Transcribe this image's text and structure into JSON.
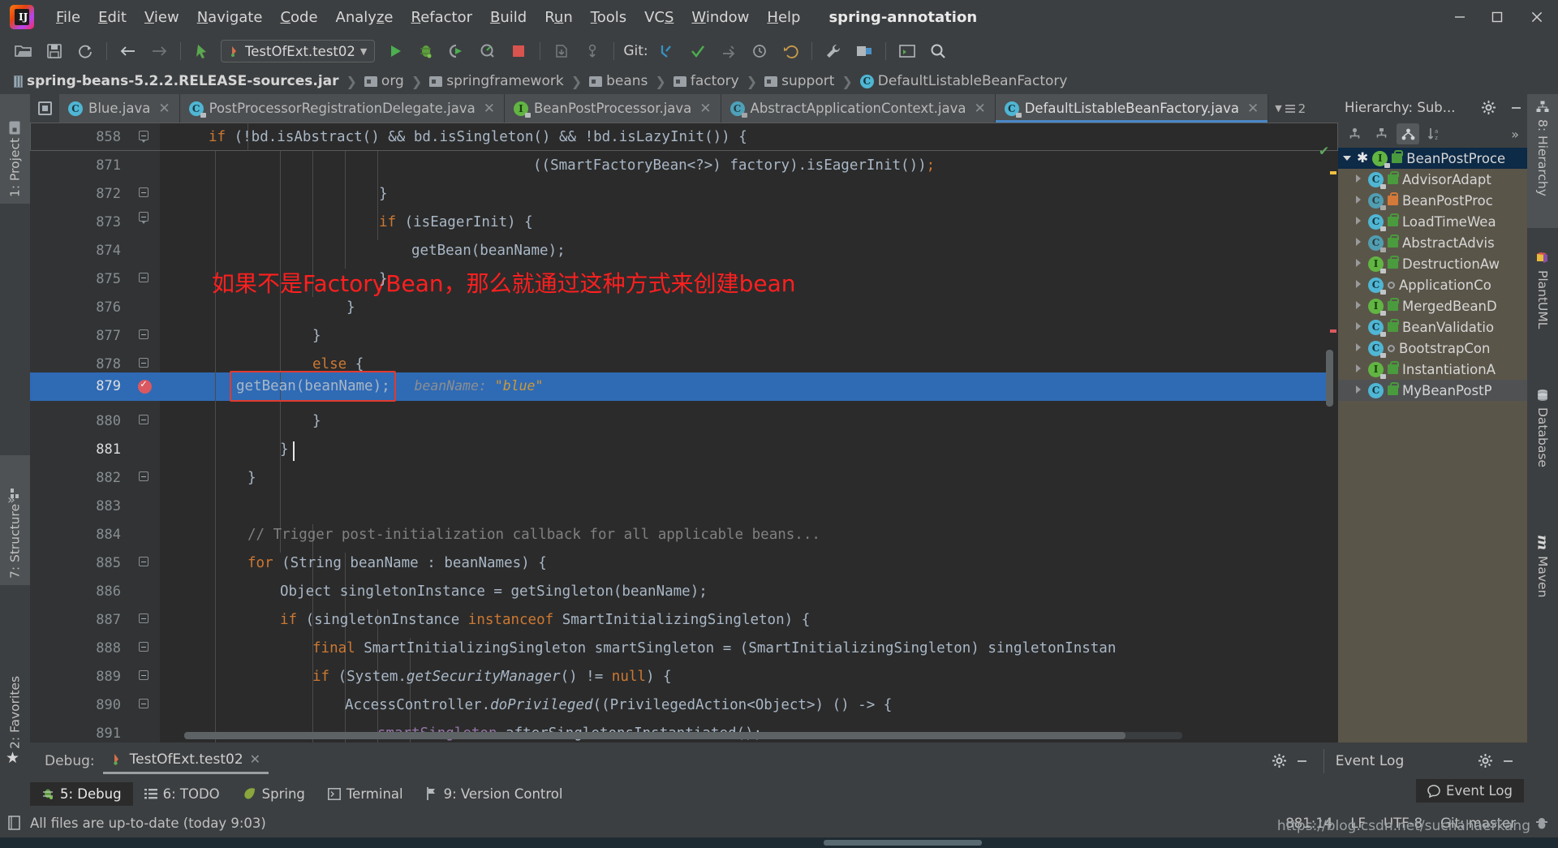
{
  "window": {
    "project_name": "spring-annotation",
    "minimize": "—",
    "maximize": "❐",
    "close": "✕"
  },
  "menu": {
    "items": [
      {
        "label": "File",
        "mnemonic": "F"
      },
      {
        "label": "Edit",
        "mnemonic": "E"
      },
      {
        "label": "View",
        "mnemonic": "V"
      },
      {
        "label": "Navigate",
        "mnemonic": "N"
      },
      {
        "label": "Code",
        "mnemonic": "C"
      },
      {
        "label": "Analyze",
        "mnemonic": "z"
      },
      {
        "label": "Refactor",
        "mnemonic": "R"
      },
      {
        "label": "Build",
        "mnemonic": "B"
      },
      {
        "label": "Run",
        "mnemonic": "u"
      },
      {
        "label": "Tools",
        "mnemonic": "T"
      },
      {
        "label": "VCS",
        "mnemonic": "S"
      },
      {
        "label": "Window",
        "mnemonic": "W"
      },
      {
        "label": "Help",
        "mnemonic": "H"
      }
    ]
  },
  "toolbar": {
    "run_config": "TestOfExt.test02",
    "git_label": "Git:",
    "icons": [
      "open-project-icon",
      "save-all-icon",
      "sync-icon",
      "back-icon",
      "forward-icon",
      "pointer-icon",
      "run-icon",
      "debug-icon",
      "run-coverage-icon",
      "profile-icon",
      "stop-icon",
      "attach-icon",
      "rerun-icon",
      "update-project-icon",
      "commit-icon",
      "push-icon",
      "settings-icon",
      "plugins-icon",
      "terminal-icon",
      "search-everywhere-icon"
    ]
  },
  "breadcrumb": {
    "items": [
      {
        "label": "spring-beans-5.2.2.RELEASE-sources.jar",
        "icon": "jar-icon"
      },
      {
        "label": "org",
        "icon": "folder-icon"
      },
      {
        "label": "springframework",
        "icon": "folder-icon"
      },
      {
        "label": "beans",
        "icon": "folder-icon"
      },
      {
        "label": "factory",
        "icon": "folder-icon"
      },
      {
        "label": "support",
        "icon": "folder-icon"
      },
      {
        "label": "DefaultListableBeanFactory",
        "icon": "class-icon"
      }
    ],
    "separator": "❯"
  },
  "editor_tabs": {
    "tabs": [
      {
        "label": "Blue.java",
        "icon": "class-icon",
        "kind": "c",
        "active": false,
        "locked": false
      },
      {
        "label": "PostProcessorRegistrationDelegate.java",
        "icon": "class-icon",
        "kind": "c",
        "active": false,
        "locked": true
      },
      {
        "label": "BeanPostProcessor.java",
        "icon": "interface-icon",
        "kind": "i",
        "active": false,
        "locked": true
      },
      {
        "label": "AbstractApplicationContext.java",
        "icon": "abstract-class-icon",
        "kind": "c",
        "active": false,
        "locked": true
      },
      {
        "label": "DefaultListableBeanFactory.java",
        "icon": "class-icon",
        "kind": "c",
        "active": true,
        "locked": true
      }
    ],
    "close_glyph": "✕",
    "overflow_count": "2"
  },
  "editor": {
    "filename": "DefaultListableBeanFactory.java",
    "annotation_note": "如果不是FactoryBean，那么就通过这种方式来创建bean",
    "annotation_color": "#ff1f1f",
    "highlight_box_color": "#e03a2f",
    "selection_color": "#2f6ab5",
    "inline_hint": {
      "name": "beanName:",
      "value": "\"blue\""
    },
    "lines": [
      {
        "num": "858",
        "indent": 0,
        "text": "        if (!bd.isAbstract() && bd.isSingleton() && !bd.isLazyInit()) {"
      },
      {
        "num": "871",
        "indent": 0,
        "text": "                            ((SmartFactoryBean<?>) factory).isEagerInit());"
      },
      {
        "num": "872",
        "indent": 0,
        "text": "                }"
      },
      {
        "num": "873",
        "indent": 0,
        "text": "                if (isEagerInit) {"
      },
      {
        "num": "874",
        "indent": 0,
        "text": "                    getBean(beanName);"
      },
      {
        "num": "875",
        "indent": 0,
        "text": "                }"
      },
      {
        "num": "876",
        "indent": 0,
        "text": "            }"
      },
      {
        "num": "877",
        "indent": 0,
        "text": "            }"
      },
      {
        "num": "878",
        "indent": 0,
        "text": "            else {"
      },
      {
        "num": "879",
        "indent": 0,
        "text": "                getBean(beanName);"
      },
      {
        "num": "880",
        "indent": 0,
        "text": "            }"
      },
      {
        "num": "881",
        "indent": 0,
        "text": "        }"
      },
      {
        "num": "882",
        "indent": 0,
        "text": "    }"
      },
      {
        "num": "883",
        "indent": 0,
        "text": ""
      },
      {
        "num": "884",
        "indent": 0,
        "text": "    // Trigger post-initialization callback for all applicable beans..."
      },
      {
        "num": "885",
        "indent": 0,
        "text": "    for (String beanName : beanNames) {"
      },
      {
        "num": "886",
        "indent": 0,
        "text": "        Object singletonInstance = getSingleton(beanName);"
      },
      {
        "num": "887",
        "indent": 0,
        "text": "        if (singletonInstance instanceof SmartInitializingSingleton) {"
      },
      {
        "num": "888",
        "indent": 0,
        "text": "            final SmartInitializingSingleton smartSingleton = (SmartInitializingSingleton) singletonInstan"
      },
      {
        "num": "889",
        "indent": 0,
        "text": "            if (System.getSecurityManager() != null) {"
      },
      {
        "num": "890",
        "indent": 0,
        "text": "                AccessController.doPrivileged((PrivilegedAction<Object>) () -> {"
      },
      {
        "num": "891",
        "indent": 0,
        "text": "                    smartSingleton.afterSingletonsInstantiated();"
      }
    ]
  },
  "left_stripe": {
    "items": [
      {
        "label": "1: Project",
        "mnemonic": "1",
        "icon": "project-folder-icon",
        "selected": true
      },
      {
        "label": "7: Structure",
        "mnemonic": "7",
        "icon": "structure-icon",
        "selected": true
      },
      {
        "label": "2: Favorites",
        "mnemonic": "2",
        "icon": "star-icon",
        "selected": false
      }
    ]
  },
  "right_stripe": {
    "items": [
      {
        "label": "8: Hierarchy",
        "mnemonic": "8",
        "icon": "hierarchy-icon",
        "selected": true
      },
      {
        "label": "PlantUML",
        "icon": "plantuml-icon",
        "selected": false
      },
      {
        "label": "Database",
        "icon": "database-icon",
        "selected": false
      },
      {
        "label": "Maven",
        "icon": "maven-icon",
        "selected": false
      }
    ]
  },
  "hierarchy": {
    "title": "Hierarchy:  Sub...",
    "gear": "⚙",
    "minimize": "—",
    "toolbar_icons": [
      "type-hierarchy-icon",
      "supertypes-hierarchy-icon",
      "subtypes-hierarchy-icon",
      "sort-alphabetically-icon",
      "more-icon"
    ],
    "more_glyph": "»",
    "rows": [
      {
        "label": "BeanPostProce",
        "kind": "i",
        "vis": "pub",
        "root": true,
        "starred": true,
        "expanded": true
      },
      {
        "label": "AdvisorAdapt",
        "kind": "c",
        "vis": "pub"
      },
      {
        "label": "BeanPostProc",
        "kind": "abs",
        "vis": "prot"
      },
      {
        "label": "LoadTimeWea",
        "kind": "c",
        "vis": "pub"
      },
      {
        "label": "AbstractAdvis",
        "kind": "abs",
        "vis": "pub"
      },
      {
        "label": "DestructionAw",
        "kind": "i",
        "vis": "pub"
      },
      {
        "label": "ApplicationCo",
        "kind": "c",
        "vis": "pkg"
      },
      {
        "label": "MergedBeanD",
        "kind": "i",
        "vis": "pub"
      },
      {
        "label": "BeanValidatio",
        "kind": "c",
        "vis": "pub"
      },
      {
        "label": "BootstrapCon",
        "kind": "c",
        "vis": "pkg"
      },
      {
        "label": "InstantiationA",
        "kind": "i",
        "vis": "pub"
      },
      {
        "label": "MyBeanPostP",
        "kind": "c",
        "vis": "pub",
        "highlighted": true
      }
    ]
  },
  "debug_panel": {
    "label": "Debug:",
    "session": "TestOfExt.test02",
    "close_glyph": "✕",
    "gear": "⚙",
    "minimize": "—"
  },
  "event_log": {
    "title": "Event Log",
    "gear": "⚙",
    "minimize": "—",
    "button": "Event Log"
  },
  "toolwindow_bar": {
    "items": [
      {
        "label": "5: Debug",
        "mnemonic": "5",
        "icon": "debug-icon",
        "selected": true
      },
      {
        "label": "6: TODO",
        "mnemonic": "6",
        "icon": "todo-icon",
        "selected": false
      },
      {
        "label": "Spring",
        "icon": "spring-leaf-icon",
        "selected": false
      },
      {
        "label": "Terminal",
        "icon": "terminal-icon",
        "selected": false
      },
      {
        "label": "9: Version Control",
        "mnemonic": "9",
        "icon": "version-control-icon",
        "selected": false
      }
    ]
  },
  "status_bar": {
    "message": "All files are up-to-date (today 9:03)",
    "caret_position": "881:14",
    "line_separator": "LF",
    "encoding": "UTF-8",
    "branch": "Git: master",
    "watermark": "https://blog.csdn.net/suchahaerkang"
  }
}
